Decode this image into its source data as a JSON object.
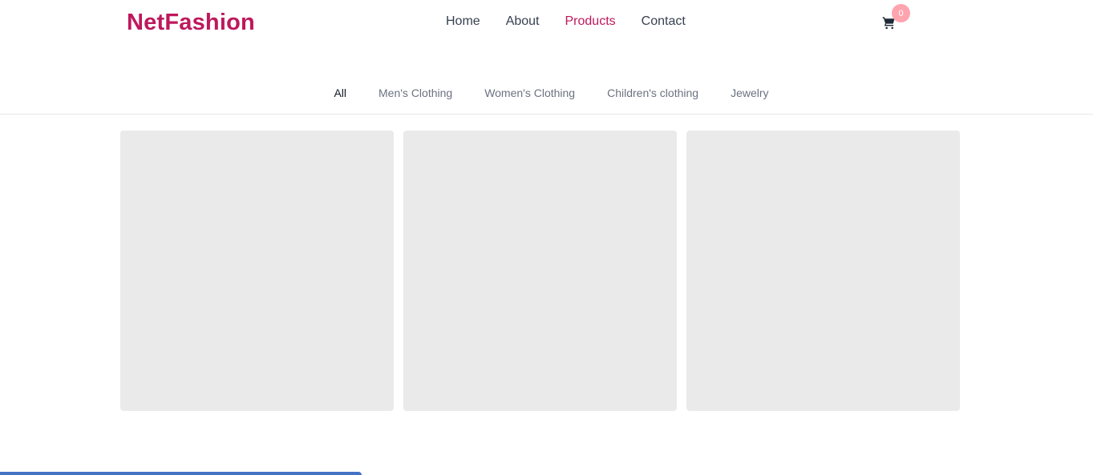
{
  "header": {
    "logo": "NetFashion",
    "nav": [
      {
        "label": "Home",
        "active": false
      },
      {
        "label": "About",
        "active": false
      },
      {
        "label": "Products",
        "active": true
      },
      {
        "label": "Contact",
        "active": false
      }
    ],
    "cart": {
      "icon": "shopping-cart-icon",
      "count": "0"
    }
  },
  "categories": {
    "tabs": [
      {
        "label": "All",
        "active": true
      },
      {
        "label": "Men's Clothing",
        "active": false
      },
      {
        "label": "Women's Clothing",
        "active": false
      },
      {
        "label": "Children's clothing",
        "active": false
      },
      {
        "label": "Jewelry",
        "active": false
      }
    ]
  },
  "products": {
    "loading": true,
    "placeholder_count": 3
  },
  "colors": {
    "brand": "#be185d",
    "badge": "#fda4af",
    "skeleton": "#eaeaea",
    "bottom_bar": "#4472c4"
  }
}
